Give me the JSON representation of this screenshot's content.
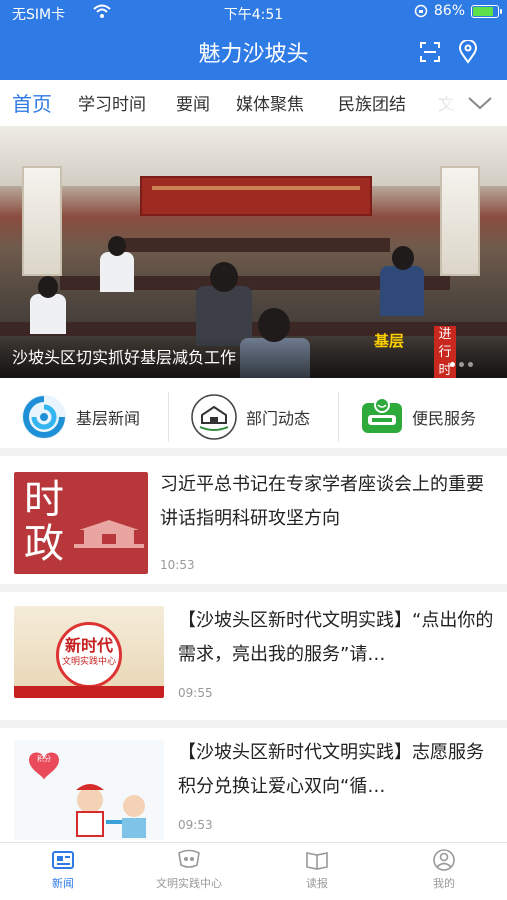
{
  "status_bar": {
    "carrier": "无SIM卡",
    "time": "下午4:51",
    "battery": "86%",
    "battery_level": 0.86
  },
  "navbar": {
    "title": "魅力沙坡头"
  },
  "tabs": [
    {
      "label": "首页"
    },
    {
      "label": "学习时间"
    },
    {
      "label": "要闻"
    },
    {
      "label": "媒体聚焦"
    },
    {
      "label": "民族团结"
    },
    {
      "label": "文"
    }
  ],
  "banner": {
    "caption": "沙坡头区切实抓好基层减负工作",
    "badge_text": "基层",
    "badge_side": "进行时"
  },
  "quick_links": [
    {
      "label": "基层新闻",
      "icon": "swirl-logo-icon"
    },
    {
      "label": "部门动态",
      "icon": "building-seal-icon"
    },
    {
      "label": "便民服务",
      "icon": "service-badge-icon"
    }
  ],
  "news": [
    {
      "title": "习近平总书记在专家学者座谈会上的重要讲话指明科研攻坚方向",
      "time": "10:53",
      "thumb_text": "时政",
      "thumb_color": "#b8373a"
    },
    {
      "title": "【沙坡头区新时代文明实践】“点出你的需求，亮出我的服务”请…",
      "time": "09:55",
      "thumb_text": "新时代",
      "thumb_sub": "文明实践中心"
    },
    {
      "title": "【沙坡头区新时代文明实践】志愿服务积分兑换让爱心双向“循…",
      "time": "09:53",
      "thumb_text": "积分"
    }
  ],
  "tabbar": [
    {
      "label": "新闻",
      "icon": "news-icon",
      "active": true
    },
    {
      "label": "文明实践中心",
      "icon": "community-icon",
      "active": false
    },
    {
      "label": "读报",
      "icon": "book-icon",
      "active": false
    },
    {
      "label": "我的",
      "icon": "profile-icon",
      "active": false
    }
  ],
  "colors": {
    "primary": "#2f7be5",
    "battery": "#5ee04a"
  }
}
